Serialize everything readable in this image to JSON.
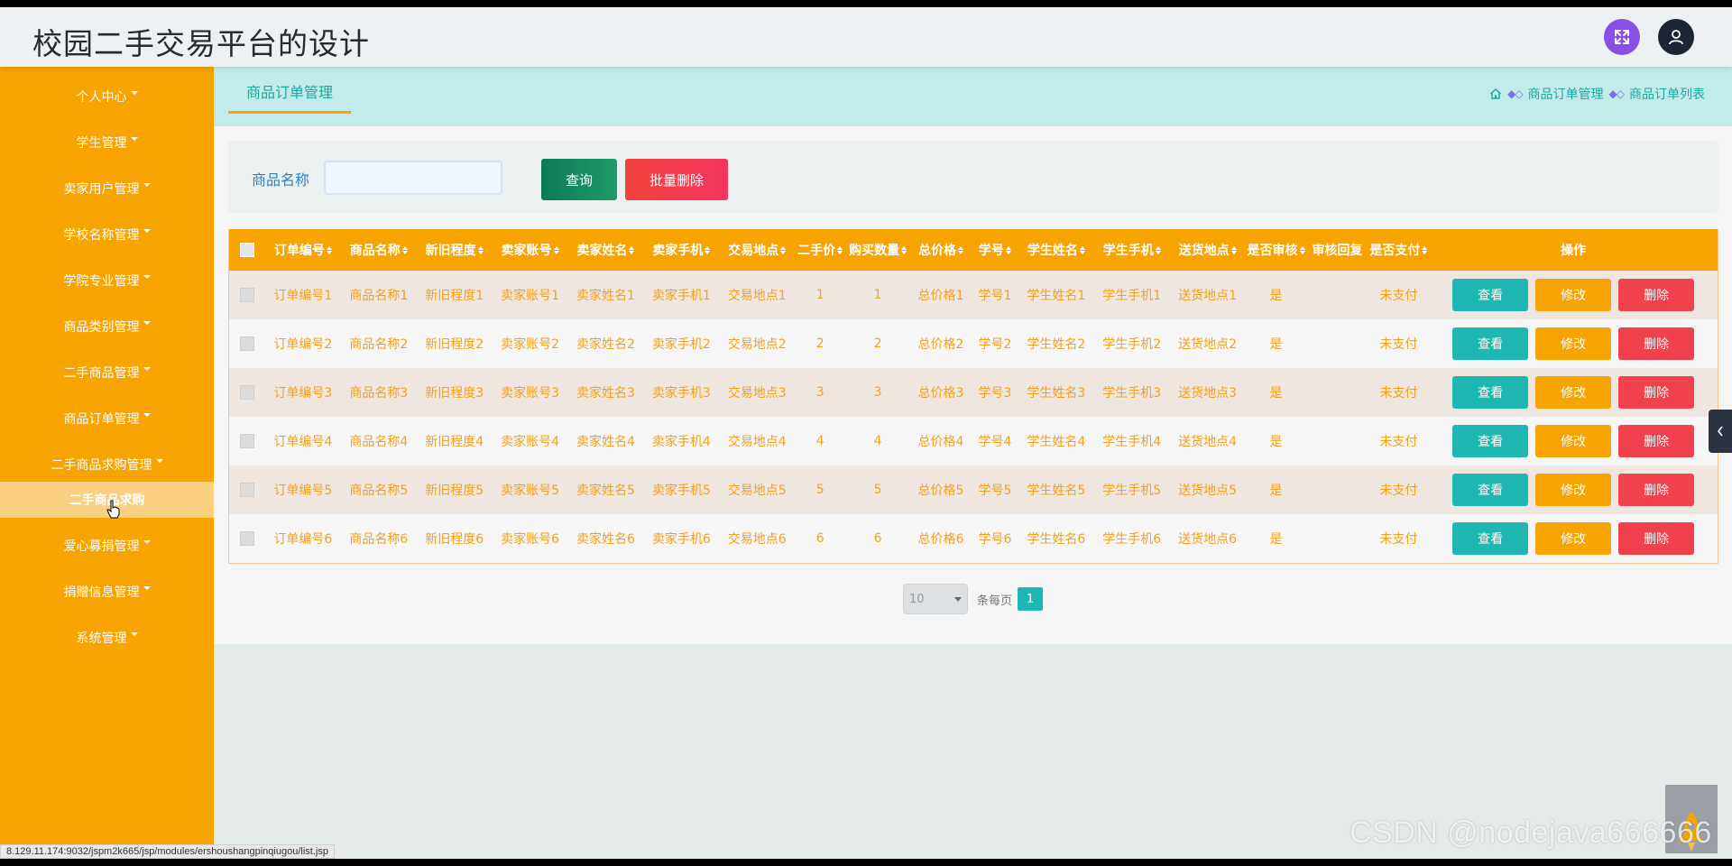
{
  "header": {
    "title": "校园二手交易平台的设计"
  },
  "sidebar": {
    "items": [
      {
        "label": "个人中心"
      },
      {
        "label": "学生管理"
      },
      {
        "label": "卖家用户管理"
      },
      {
        "label": "学校名称管理"
      },
      {
        "label": "学院专业管理"
      },
      {
        "label": "商品类别管理"
      },
      {
        "label": "二手商品管理"
      },
      {
        "label": "商品订单管理"
      },
      {
        "label": "二手商品求购管理"
      },
      {
        "label": "爱心募捐管理"
      },
      {
        "label": "捐赠信息管理"
      },
      {
        "label": "系统管理"
      }
    ],
    "active_sub": {
      "label": "二手商品求购"
    }
  },
  "tabs": {
    "active": "商品订单管理"
  },
  "breadcrumb": {
    "level1": "商品订单管理",
    "level2": "商品订单列表"
  },
  "search": {
    "label": "商品名称",
    "value": "",
    "query_label": "查询",
    "batch_delete_label": "批量删除"
  },
  "table": {
    "headers": [
      "订单编号",
      "商品名称",
      "新旧程度",
      "卖家账号",
      "卖家姓名",
      "卖家手机",
      "交易地点",
      "二手价",
      "购买数量",
      "总价格",
      "学号",
      "学生姓名",
      "学生手机",
      "送货地点",
      "是否审核",
      "审核回复",
      "是否支付",
      "操作"
    ],
    "rows": [
      [
        "订单编号1",
        "商品名称1",
        "新旧程度1",
        "卖家账号1",
        "卖家姓名1",
        "卖家手机1",
        "交易地点1",
        "1",
        "1",
        "总价格1",
        "学号1",
        "学生姓名1",
        "学生手机1",
        "送货地点1",
        "是",
        "",
        "未支付"
      ],
      [
        "订单编号2",
        "商品名称2",
        "新旧程度2",
        "卖家账号2",
        "卖家姓名2",
        "卖家手机2",
        "交易地点2",
        "2",
        "2",
        "总价格2",
        "学号2",
        "学生姓名2",
        "学生手机2",
        "送货地点2",
        "是",
        "",
        "未支付"
      ],
      [
        "订单编号3",
        "商品名称3",
        "新旧程度3",
        "卖家账号3",
        "卖家姓名3",
        "卖家手机3",
        "交易地点3",
        "3",
        "3",
        "总价格3",
        "学号3",
        "学生姓名3",
        "学生手机3",
        "送货地点3",
        "是",
        "",
        "未支付"
      ],
      [
        "订单编号4",
        "商品名称4",
        "新旧程度4",
        "卖家账号4",
        "卖家姓名4",
        "卖家手机4",
        "交易地点4",
        "4",
        "4",
        "总价格4",
        "学号4",
        "学生姓名4",
        "学生手机4",
        "送货地点4",
        "是",
        "",
        "未支付"
      ],
      [
        "订单编号5",
        "商品名称5",
        "新旧程度5",
        "卖家账号5",
        "卖家姓名5",
        "卖家手机5",
        "交易地点5",
        "5",
        "5",
        "总价格5",
        "学号5",
        "学生姓名5",
        "学生手机5",
        "送货地点5",
        "是",
        "",
        "未支付"
      ],
      [
        "订单编号6",
        "商品名称6",
        "新旧程度6",
        "卖家账号6",
        "卖家姓名6",
        "卖家手机6",
        "交易地点6",
        "6",
        "6",
        "总价格6",
        "学号6",
        "学生姓名6",
        "学生手机6",
        "送货地点6",
        "是",
        "",
        "未支付"
      ]
    ],
    "actions": {
      "view": "查看",
      "edit": "修改",
      "delete": "删除"
    }
  },
  "pagination": {
    "page_size": "10",
    "per_page_label": "条每页",
    "current_page": "1"
  },
  "watermark": "CSDN @nodejava666666",
  "status_url": "8.129.11.174:9032/jspm2k665/jsp/modules/ershoushangpinqiugou/list.jsp",
  "colors": {
    "primary": "#f7a300",
    "teal": "#1fb7b2",
    "danger": "#f0414d",
    "header_bg": "#eef1f3",
    "tabbar_bg": "#c2ece9"
  },
  "icons": {
    "fullscreen": "expand-arrows-icon",
    "user": "user-icon",
    "home": "home-icon",
    "rocket": "rocket-icon",
    "collapse": "chevron-left-icon"
  }
}
